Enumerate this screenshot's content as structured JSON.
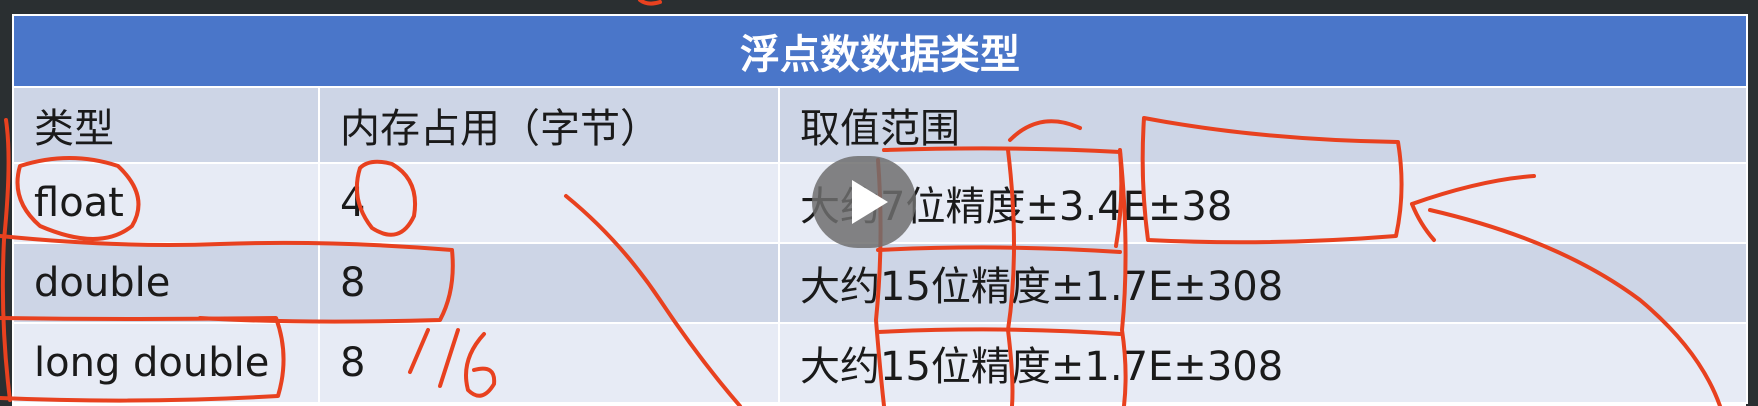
{
  "table": {
    "title": "浮点数数据类型",
    "headers": [
      "类型",
      "内存占用（字节）",
      "取值范围"
    ],
    "rows": [
      [
        "float",
        "4",
        "大约7位精度±3.4E±38"
      ],
      [
        "double",
        "8",
        "大约15位精度±1.7E±308"
      ],
      [
        "long double",
        "8",
        "大约15位精度±1.7E±308"
      ]
    ]
  },
  "annotations": {
    "ink_color": "#e8411f",
    "handwritten_mark": "//6"
  },
  "player": {
    "icon": "play-icon"
  }
}
